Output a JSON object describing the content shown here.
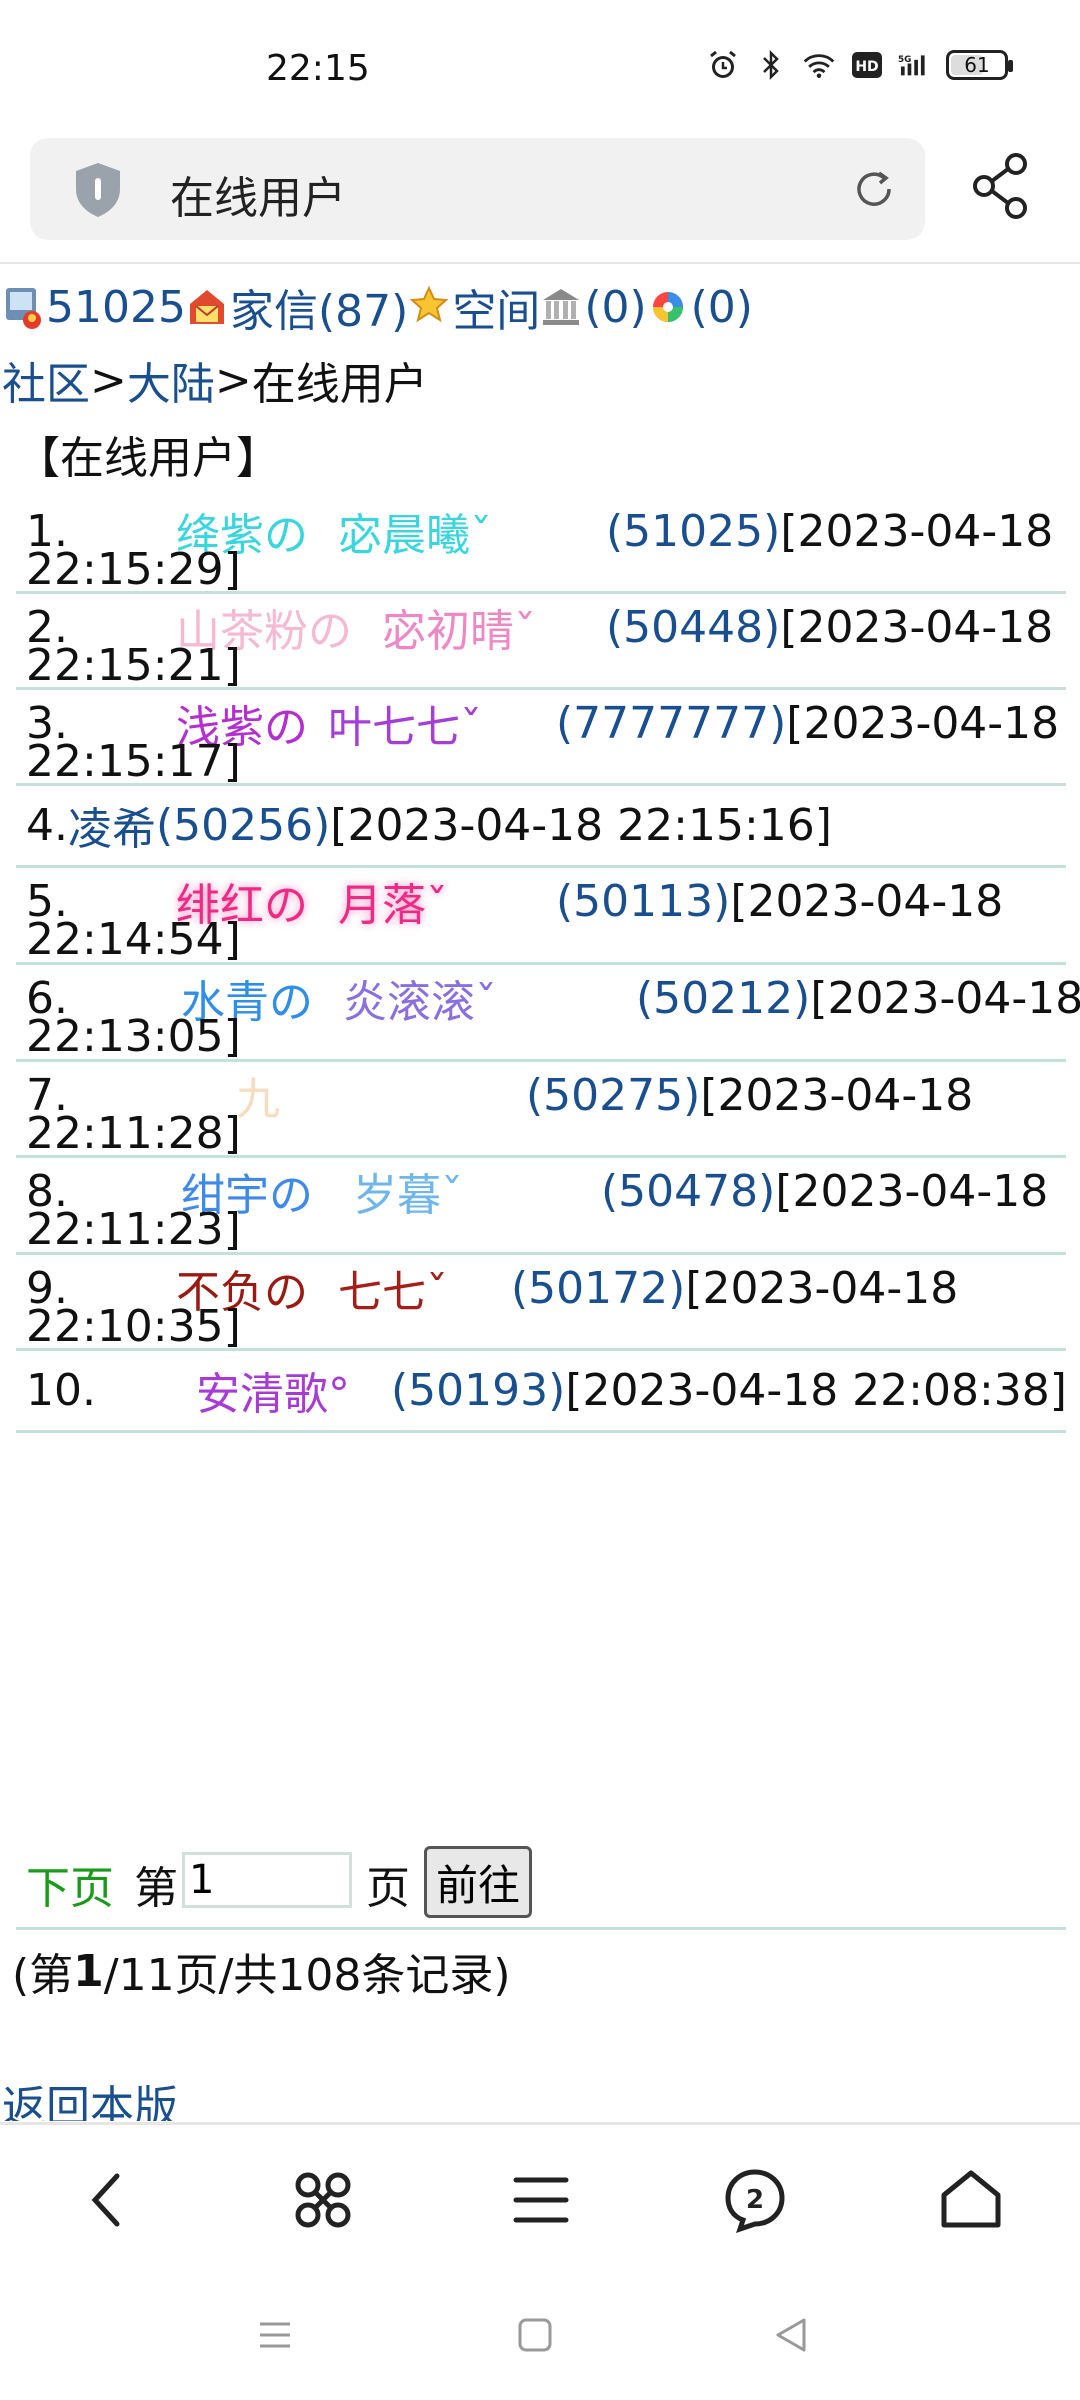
{
  "status": {
    "time": "22:15",
    "battery": "61",
    "battery_level": 0.61
  },
  "address": {
    "title": "在线用户"
  },
  "userbar": {
    "id": "51025",
    "mail_label": "家信(87)",
    "space_label": "空间",
    "bank_label": "(0)",
    "photo_label": "(0)"
  },
  "breadcrumb": {
    "community": "社区",
    "sep1": ">",
    "region": "大陆",
    "sep2": ">",
    "current": "在线用户"
  },
  "section_title": "【在线用户】",
  "users": [
    {
      "num": "1.",
      "segments": [
        {
          "text": "绛紫の",
          "color": "#3bd6dd"
        },
        {
          "text": "宓晨曦ˇ",
          "color": "#3bd6dd"
        }
      ],
      "uid": "(51025)",
      "time1": "[2023-04-18",
      "time2": "22:15:29]"
    },
    {
      "num": "2.",
      "segments": [
        {
          "text": "山茶粉の",
          "color": "#f5b9d3"
        },
        {
          "text": "宓初晴ˇ",
          "color": "#ee88c4"
        }
      ],
      "uid": "(50448)",
      "time1": "[2023-04-18",
      "time2": "22:15:21]"
    },
    {
      "num": "3.",
      "segments": [
        {
          "text": "浅紫の",
          "color": "#b42fd0"
        },
        {
          "text": "叶七七ˇ",
          "color": "#a43ed6"
        }
      ],
      "uid": "(7777777)",
      "time1": "[2023-04-18",
      "time2": "22:15:17]"
    },
    {
      "num": "4.",
      "name": "凌希",
      "uid": "(50256)",
      "time1": "[2023-04-18 22:15:16]"
    },
    {
      "num": "5.",
      "segments": [
        {
          "text": "绯红の",
          "color": "#ee2a86"
        },
        {
          "text": "月落ˇ",
          "color": "#ee2a86"
        }
      ],
      "uid": "(50113)",
      "time1": "[2023-04-18",
      "time2": "22:14:54]"
    },
    {
      "num": "6.",
      "segments": [
        {
          "text": "水青の",
          "color": "#2f8ee6"
        },
        {
          "text": "炎滚滚ˇ",
          "color": "#8a6fe0"
        }
      ],
      "uid": "(50212)",
      "time1": "[2023-04-18",
      "time2": "22:13:05]"
    },
    {
      "num": "7.",
      "segments": [
        {
          "text": "九",
          "color": "#f6dcc0"
        }
      ],
      "uid": "(50275)",
      "time1": "[2023-04-18",
      "time2": "22:11:28]"
    },
    {
      "num": "8.",
      "segments": [
        {
          "text": "绀宇の",
          "color": "#3f8ae8"
        },
        {
          "text": "岁暮ˇ",
          "color": "#6fb6ea"
        }
      ],
      "uid": "(50478)",
      "time1": "[2023-04-18",
      "time2": "22:11:23]"
    },
    {
      "num": "9.",
      "segments": [
        {
          "text": "不负の",
          "color": "#9a1a12"
        },
        {
          "text": "七七ˇ",
          "color": "#a51e18"
        }
      ],
      "uid": "(50172)",
      "time1": "[2023-04-18",
      "time2": "22:10:35]"
    },
    {
      "num": "10.",
      "segments": [
        {
          "text": "安清歌°",
          "color": "#a83ad6"
        }
      ],
      "uid": "(50193)",
      "time1": "[2023-04-18 22:08:38]"
    }
  ],
  "pager": {
    "next": "下页",
    "page_label": "第",
    "page_value": "1",
    "page_unit": "页",
    "go": "前往"
  },
  "page_info": {
    "open": "(第",
    "current": "1",
    "rest": "/11页/共108条记录)"
  },
  "back_link": "返回本版",
  "colors": {
    "link": "#1a4f8f",
    "divider": "#c3e0dc",
    "next": "#1a9a1a"
  }
}
